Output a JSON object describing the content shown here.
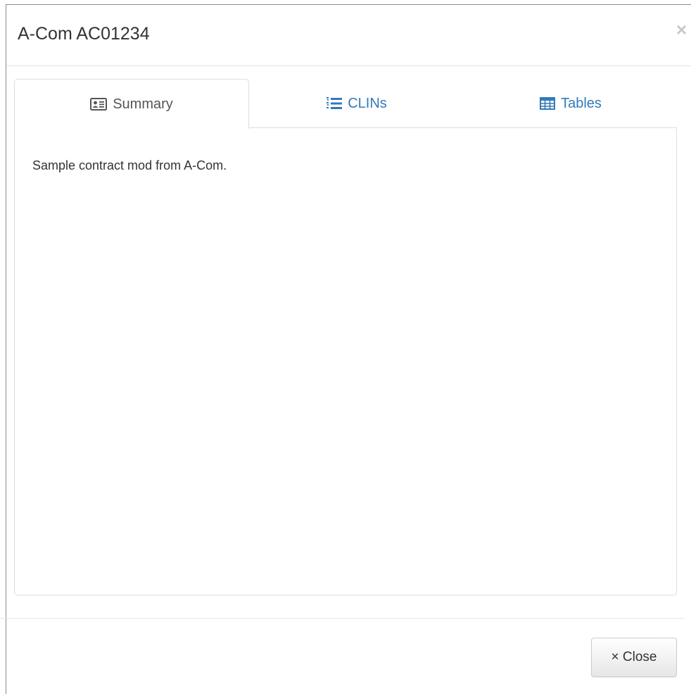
{
  "modal": {
    "title": "A-Com AC01234",
    "close_icon": "×"
  },
  "tabs": [
    {
      "label": "Summary",
      "icon": "id-card-icon",
      "active": true
    },
    {
      "label": "CLINs",
      "icon": "list-ordered-icon",
      "active": false
    },
    {
      "label": "Tables",
      "icon": "table-icon",
      "active": false
    }
  ],
  "summary": {
    "text": "Sample contract mod from A-Com."
  },
  "footer": {
    "close_label": "× Close"
  },
  "colors": {
    "link": "#337ab7",
    "active_tab_text": "#555555",
    "border": "#dddddd"
  }
}
